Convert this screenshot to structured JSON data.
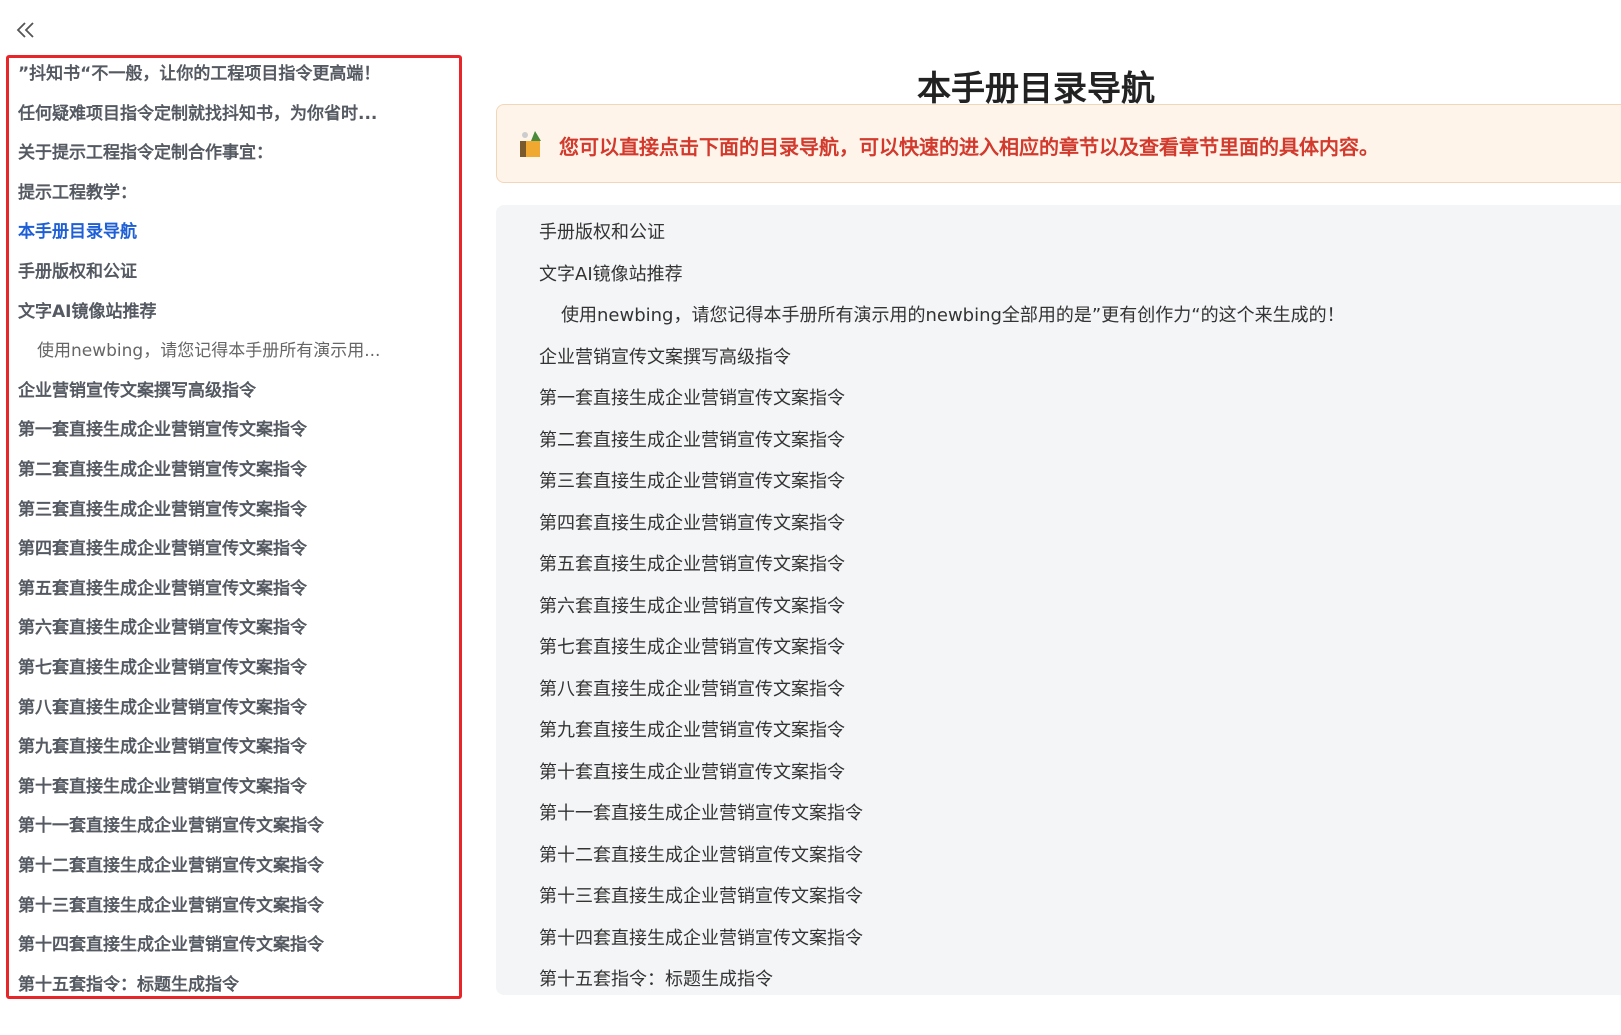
{
  "sidebar": {
    "collapse_label": "«",
    "items": [
      {
        "label": "”抖知书“不一般，让你的工程项目指令更高端！",
        "level": 1
      },
      {
        "label": "任何疑难项目指令定制就找抖知书，为你省时...",
        "level": 1
      },
      {
        "label": "关于提示工程指令定制合作事宜：",
        "level": 1
      },
      {
        "label": "提示工程教学：",
        "level": 1
      },
      {
        "label": "本手册目录导航",
        "level": 1,
        "active": true
      },
      {
        "label": "手册版权和公证",
        "level": 1
      },
      {
        "label": "文字AI镜像站推荐",
        "level": 1
      },
      {
        "label": "使用newbing，请您记得本手册所有演示用...",
        "level": 2
      },
      {
        "label": "企业营销宣传文案撰写高级指令",
        "level": 1
      },
      {
        "label": "第一套直接生成企业营销宣传文案指令",
        "level": 1
      },
      {
        "label": "第二套直接生成企业营销宣传文案指令",
        "level": 1
      },
      {
        "label": "第三套直接生成企业营销宣传文案指令",
        "level": 1
      },
      {
        "label": "第四套直接生成企业营销宣传文案指令",
        "level": 1
      },
      {
        "label": "第五套直接生成企业营销宣传文案指令",
        "level": 1
      },
      {
        "label": "第六套直接生成企业营销宣传文案指令",
        "level": 1
      },
      {
        "label": "第七套直接生成企业营销宣传文案指令",
        "level": 1
      },
      {
        "label": "第八套直接生成企业营销宣传文案指令",
        "level": 1
      },
      {
        "label": "第九套直接生成企业营销宣传文案指令",
        "level": 1
      },
      {
        "label": "第十套直接生成企业营销宣传文案指令",
        "level": 1
      },
      {
        "label": "第十一套直接生成企业营销宣传文案指令",
        "level": 1
      },
      {
        "label": "第十二套直接生成企业营销宣传文案指令",
        "level": 1
      },
      {
        "label": "第十三套直接生成企业营销宣传文案指令",
        "level": 1
      },
      {
        "label": "第十四套直接生成企业营销宣传文案指令",
        "level": 1
      },
      {
        "label": "第十五套指令：标题生成指令",
        "level": 1
      }
    ]
  },
  "main": {
    "title": "本手册目录导航",
    "callout": {
      "icon": "books-emoji-icon",
      "text": "您可以直接点击下面的目录导航，可以快速的进入相应的章节以及查看章节里面的具体内容。"
    },
    "toc": [
      {
        "label": "手册版权和公证",
        "level": 1
      },
      {
        "label": "文字AI镜像站推荐",
        "level": 1
      },
      {
        "label": "使用newbing，请您记得本手册所有演示用的newbing全部用的是”更有创作力“的这个来生成的！",
        "level": 2
      },
      {
        "label": "企业营销宣传文案撰写高级指令",
        "level": 1
      },
      {
        "label": "第一套直接生成企业营销宣传文案指令",
        "level": 1
      },
      {
        "label": "第二套直接生成企业营销宣传文案指令",
        "level": 1
      },
      {
        "label": "第三套直接生成企业营销宣传文案指令",
        "level": 1
      },
      {
        "label": "第四套直接生成企业营销宣传文案指令",
        "level": 1
      },
      {
        "label": "第五套直接生成企业营销宣传文案指令",
        "level": 1
      },
      {
        "label": "第六套直接生成企业营销宣传文案指令",
        "level": 1
      },
      {
        "label": "第七套直接生成企业营销宣传文案指令",
        "level": 1
      },
      {
        "label": "第八套直接生成企业营销宣传文案指令",
        "level": 1
      },
      {
        "label": "第九套直接生成企业营销宣传文案指令",
        "level": 1
      },
      {
        "label": "第十套直接生成企业营销宣传文案指令",
        "level": 1
      },
      {
        "label": "第十一套直接生成企业营销宣传文案指令",
        "level": 1
      },
      {
        "label": "第十二套直接生成企业营销宣传文案指令",
        "level": 1
      },
      {
        "label": "第十三套直接生成企业营销宣传文案指令",
        "level": 1
      },
      {
        "label": "第十四套直接生成企业营销宣传文案指令",
        "level": 1
      },
      {
        "label": "第十五套指令：标题生成指令",
        "level": 1
      }
    ]
  },
  "colors": {
    "accent": "#1e5fd6",
    "highlight_border": "#e8262a",
    "callout_text": "#d23a2e",
    "callout_bg": "#fff4ea"
  }
}
